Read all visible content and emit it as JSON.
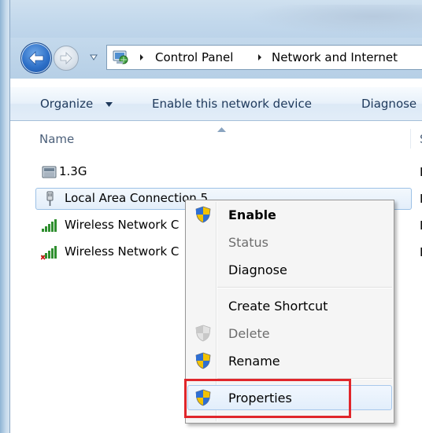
{
  "address": {
    "crumbs": [
      "Control Panel",
      "Network and Internet"
    ]
  },
  "toolbar": {
    "organize_label": "Organize",
    "enable_label": "Enable this network device",
    "diagnose_label": "Diagnose"
  },
  "columns": {
    "name": "Name",
    "second_initial": "S"
  },
  "connections": [
    {
      "label": "1.3G",
      "icon": "dialup-modem-icon",
      "edge": "I"
    },
    {
      "label": "Local Area Connection 5",
      "icon": "lan-adapter-icon",
      "edge": "I"
    },
    {
      "label": "Wireless Network C",
      "icon": "wireless-signal-icon",
      "edge": "I"
    },
    {
      "label": "Wireless Network C",
      "icon": "wireless-signal-disabled-icon",
      "edge": "I"
    }
  ],
  "context_menu": {
    "items": [
      {
        "label": "Enable",
        "style": "bold",
        "icon": "uac-shield-icon"
      },
      {
        "label": "Status",
        "style": "disabled",
        "icon": ""
      },
      {
        "label": "Diagnose",
        "style": "normal",
        "icon": ""
      },
      {
        "label": "Create Shortcut",
        "style": "normal",
        "icon": ""
      },
      {
        "label": "Delete",
        "style": "disabled",
        "icon": "uac-shield-disabled-icon"
      },
      {
        "label": "Rename",
        "style": "normal",
        "icon": "uac-shield-icon"
      },
      {
        "label": "Properties",
        "style": "hover",
        "icon": "uac-shield-icon"
      }
    ]
  },
  "colors": {
    "highlight_box": "#e0262b",
    "toolbar_text": "#1e395b",
    "selection_border": "#9cc1e6"
  }
}
